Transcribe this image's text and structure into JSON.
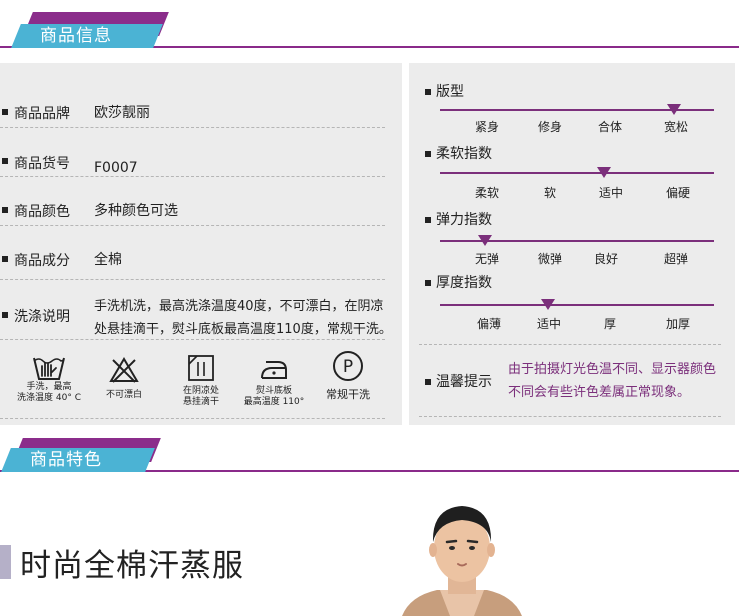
{
  "section_info": {
    "title": "商品信息"
  },
  "info_rows": [
    {
      "label": "商品品牌",
      "value": "欧莎靓丽"
    },
    {
      "label": "商品货号",
      "value": "F0007"
    },
    {
      "label": "商品颜色",
      "value": "多种颜色可选"
    },
    {
      "label": "商品成分",
      "value": "全棉"
    }
  ],
  "wash": {
    "label": "洗涤说明",
    "line1": "手洗机洗，最高洗涤温度40度，不可漂白，在阴凉",
    "line2": "处悬挂滴干，熨斗底板最高温度110度，常规干洗。"
  },
  "care_icons": [
    {
      "icon": "hand-wash-icon",
      "line1": "手洗，最高",
      "line2": "洗涤温度 40° C"
    },
    {
      "icon": "no-bleach-icon",
      "line1": "不可漂白",
      "line2": ""
    },
    {
      "icon": "hang-dry-shade-icon",
      "line1": "在阴凉处",
      "line2": "悬挂滴干"
    },
    {
      "icon": "iron-icon",
      "line1": "熨斗底板",
      "line2": "最高温度 110°"
    },
    {
      "icon": "dry-clean-icon",
      "line1": "常规干洗",
      "line2": ""
    }
  ],
  "scales": [
    {
      "title": "版型",
      "ticks": [
        "紧身",
        "修身",
        "合体",
        "宽松"
      ],
      "selected": "宽松",
      "level": 0.86
    },
    {
      "title": "柔软指数",
      "ticks": [
        "柔软",
        "软",
        "适中",
        "偏硬"
      ],
      "selected": "适中",
      "level": 0.6
    },
    {
      "title": "弹力指数",
      "ticks": [
        "无弹",
        "微弹",
        "良好",
        "超弹"
      ],
      "selected": "无弹",
      "level": 0.17
    },
    {
      "title": "厚度指数",
      "ticks": [
        "偏薄",
        "适中",
        "厚",
        "加厚"
      ],
      "selected": "适中",
      "level": 0.39
    }
  ],
  "notice": {
    "label": "温馨提示",
    "line1": "由于拍摄灯光色温不同、显示器颜色",
    "line2": "不同会有些许色差属正常现象。"
  },
  "section_feature": {
    "title": "商品特色"
  },
  "feature": {
    "headline": "时尚全棉汗蒸服"
  },
  "colors": {
    "tab_blue": "#4bb3d4",
    "accent_purple": "#7b2f7b",
    "panel_gray": "#ececec"
  }
}
